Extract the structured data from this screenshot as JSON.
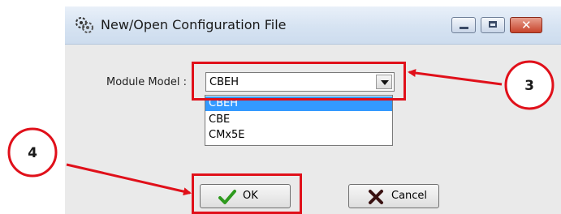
{
  "window": {
    "title": "New/Open  Configuration File",
    "controls": {
      "minimize": "",
      "maximize": "",
      "close": "✕"
    }
  },
  "form": {
    "module_model_label": "Module Model :",
    "module_model_value": "CBEH",
    "options": [
      "CBEH",
      "CBE",
      "CMx5E"
    ],
    "selected_index": 0
  },
  "buttons": {
    "ok": "OK",
    "cancel": "Cancel"
  },
  "annotations": {
    "step3": "3",
    "step4": "4",
    "color": "#e0101a"
  },
  "icons": [
    "app-gear-icon",
    "minimize-icon",
    "maximize-icon",
    "close-icon",
    "dropdown-arrow-icon",
    "checkmark-icon",
    "cancel-x-icon"
  ]
}
